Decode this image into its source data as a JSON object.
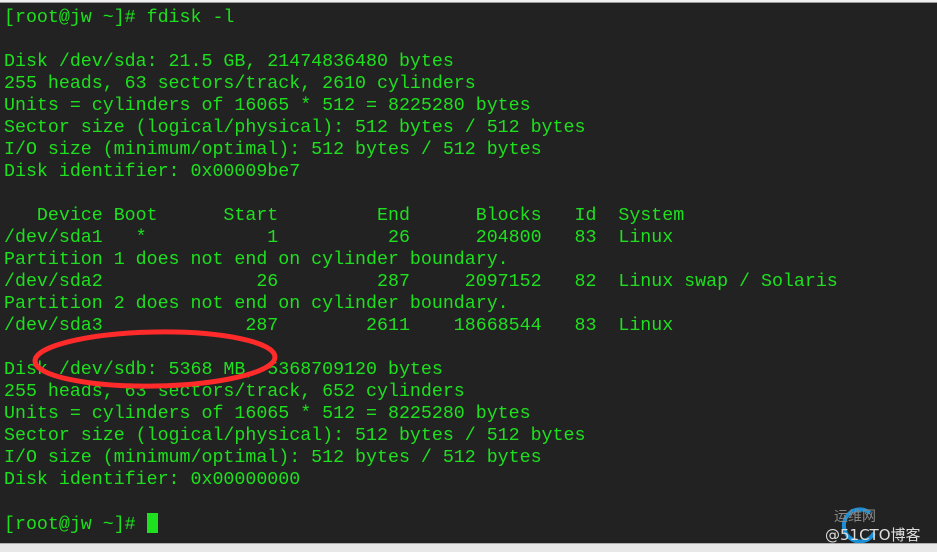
{
  "terminal": {
    "lines": [
      "[root@jw ~]# fdisk -l",
      "",
      "Disk /dev/sda: 21.5 GB, 21474836480 bytes",
      "255 heads, 63 sectors/track, 2610 cylinders",
      "Units = cylinders of 16065 * 512 = 8225280 bytes",
      "Sector size (logical/physical): 512 bytes / 512 bytes",
      "I/O size (minimum/optimal): 512 bytes / 512 bytes",
      "Disk identifier: 0x00009be7",
      "",
      "   Device Boot      Start         End      Blocks   Id  System",
      "/dev/sda1   *           1          26      204800   83  Linux",
      "Partition 1 does not end on cylinder boundary.",
      "/dev/sda2              26         287     2097152   82  Linux swap / Solaris",
      "Partition 2 does not end on cylinder boundary.",
      "/dev/sda3             287        2611    18668544   83  Linux",
      "",
      "Disk /dev/sdb: 5368 MB, 5368709120 bytes",
      "255 heads, 63 sectors/track, 652 cylinders",
      "Units = cylinders of 16065 * 512 = 8225280 bytes",
      "Sector size (logical/physical): 512 bytes / 512 bytes",
      "I/O size (minimum/optimal): 512 bytes / 512 bytes",
      "Disk identifier: 0x00000000",
      ""
    ],
    "prompt": "[root@jw ~]# ",
    "text_color": "#1ee01e",
    "background": "#222222",
    "highlight_color": "#ff2a2a"
  },
  "watermark": {
    "line1": "运维网",
    "line2": "@51CTO博客",
    "logo": "iyunv.com"
  }
}
